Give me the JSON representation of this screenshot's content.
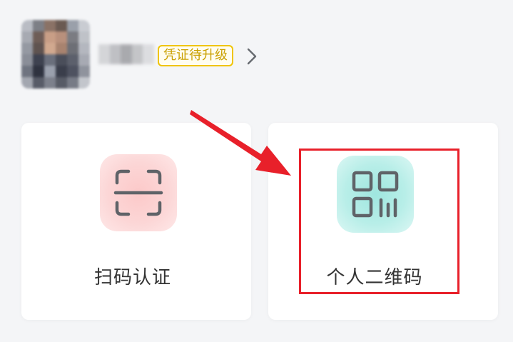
{
  "profile": {
    "badge_label": "凭证待升级",
    "chevron_icon": "chevron-right-icon"
  },
  "actions": [
    {
      "label": "扫码认证",
      "icon": "scan-icon",
      "tile_color": "#f9c9c9"
    },
    {
      "label": "个人二维码",
      "icon": "qr-code-icon",
      "tile_color": "#9fe6df"
    }
  ],
  "colors": {
    "badge_border": "#f0c400",
    "badge_text": "#caa000",
    "annotation": "#e8202a",
    "icon_stroke": "#5f6368"
  }
}
